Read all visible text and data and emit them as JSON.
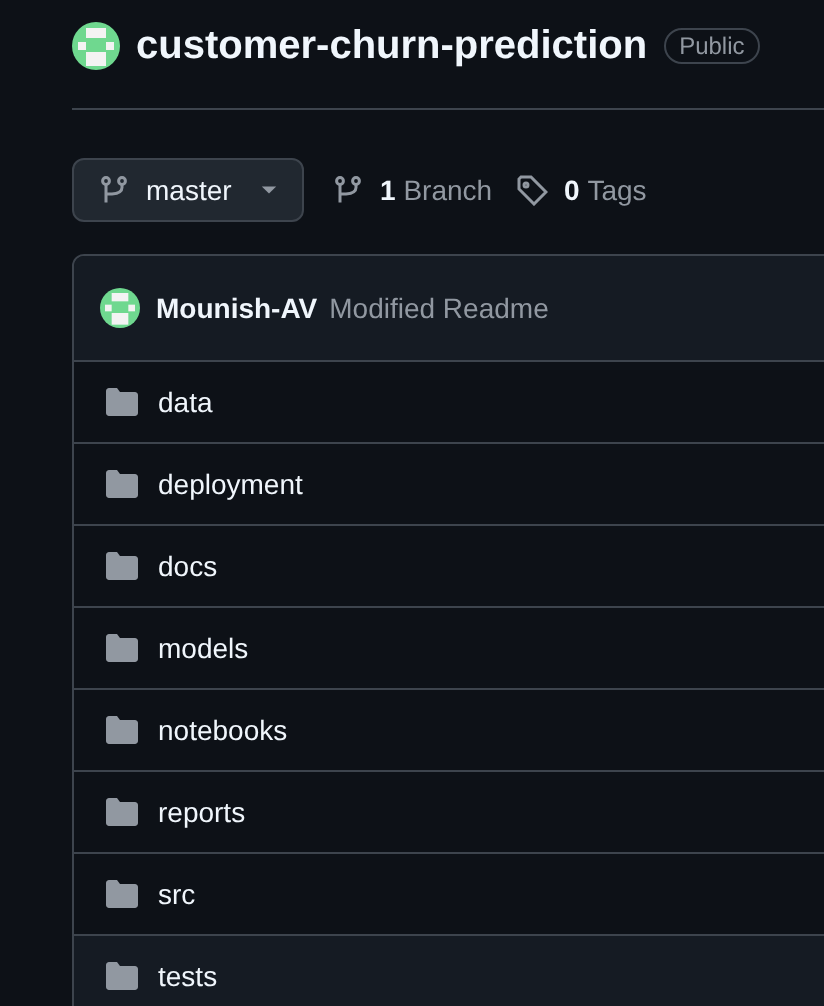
{
  "repo": {
    "name": "customer-churn-prediction",
    "visibility": "Public"
  },
  "branch_button": {
    "label": "master"
  },
  "branches": {
    "count": "1",
    "label": "Branch"
  },
  "tags": {
    "count": "0",
    "label": "Tags"
  },
  "commit": {
    "author": "Mounish-AV",
    "message": "Modified Readme"
  },
  "files": [
    {
      "name": "data",
      "selected": false
    },
    {
      "name": "deployment",
      "selected": false
    },
    {
      "name": "docs",
      "selected": false
    },
    {
      "name": "models",
      "selected": false
    },
    {
      "name": "notebooks",
      "selected": false
    },
    {
      "name": "reports",
      "selected": false
    },
    {
      "name": "src",
      "selected": false
    },
    {
      "name": "tests",
      "selected": true
    }
  ]
}
